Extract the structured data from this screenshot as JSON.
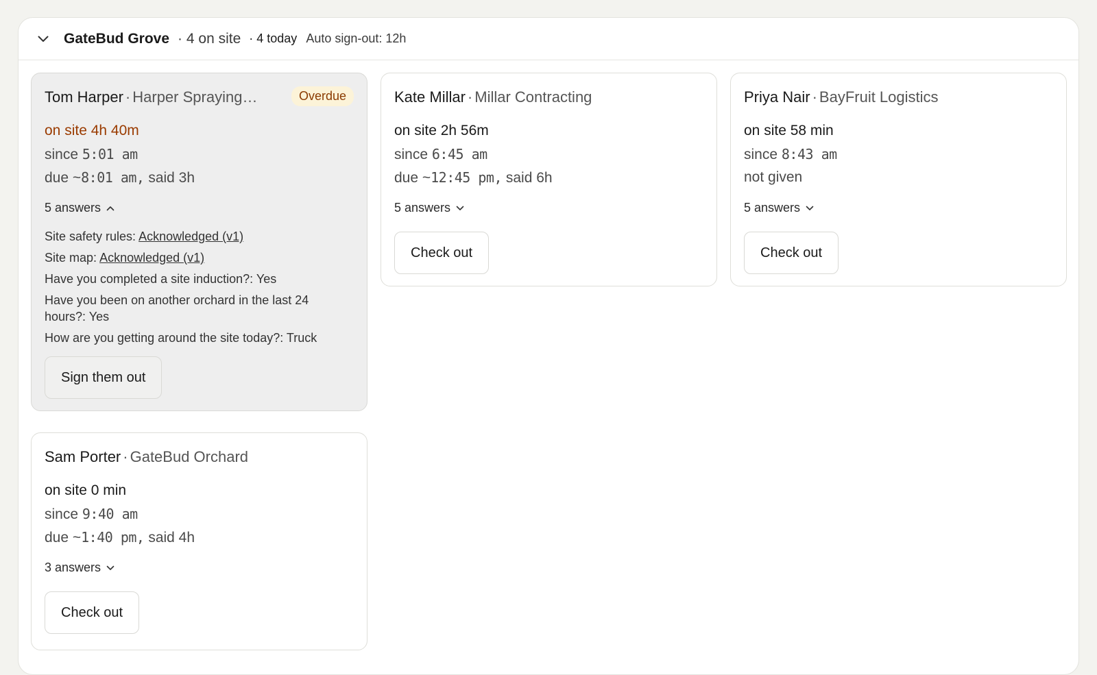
{
  "header": {
    "site_name": "GateBud Grove",
    "on_site": "· 4 on site",
    "today": "· 4 today",
    "auto_signout": "Auto sign-out: 12h"
  },
  "cards": [
    {
      "name": "Tom Harper",
      "sep": "·",
      "org": "Harper Spraying…",
      "badge": "Overdue",
      "duration": "on site 4h 40m",
      "since_prefix": "since",
      "since_time": "5:01 am",
      "due_prefix": "due ~",
      "due_time": "8:01 am,",
      "due_said": "said 3h",
      "answers_label": "5 answers",
      "answers": [
        {
          "q": "Site safety rules:",
          "a": "Acknowledged (v1)"
        },
        {
          "q": "Site map:",
          "a": "Acknowledged (v1)"
        },
        {
          "q": "Have you completed a site induction?:",
          "a": "Yes"
        },
        {
          "q": "Have you been on another orchard in the last 24 hours?:",
          "a": "Yes"
        },
        {
          "q": "How are you getting around the site today?:",
          "a": "Truck"
        }
      ],
      "button": "Sign them out"
    },
    {
      "name": "Kate Millar",
      "sep": "·",
      "org": "Millar Contracting",
      "duration": "on site 2h 56m",
      "since_prefix": "since",
      "since_time": "6:45 am",
      "due_prefix": "due ~",
      "due_time": "12:45 pm,",
      "due_said": "said 6h",
      "answers_label": "5 answers",
      "button": "Check out"
    },
    {
      "name": "Priya Nair",
      "sep": "·",
      "org": "BayFruit Logistics",
      "duration": "on site 58 min",
      "since_prefix": "since",
      "since_time": "8:43 am",
      "due_text": "not given",
      "answers_label": "5 answers",
      "button": "Check out"
    },
    {
      "name": "Sam Porter",
      "sep": "·",
      "org": "GateBud Orchard",
      "duration": "on site 0 min",
      "since_prefix": "since",
      "since_time": "9:40 am",
      "due_prefix": "due ~",
      "due_time": "1:40 pm,",
      "due_said": "said 4h",
      "answers_label": "3 answers",
      "button": "Check out"
    }
  ],
  "colors": {
    "overdue_text": "#9a3b00",
    "badge_bg": "#fcf3d8",
    "overdue_card_bg": "#eeeeee"
  },
  "icons": {
    "collapse": "chevron-down-icon",
    "answers_expanded": "chevron-up-icon",
    "answers_collapsed": "chevron-down-icon"
  }
}
